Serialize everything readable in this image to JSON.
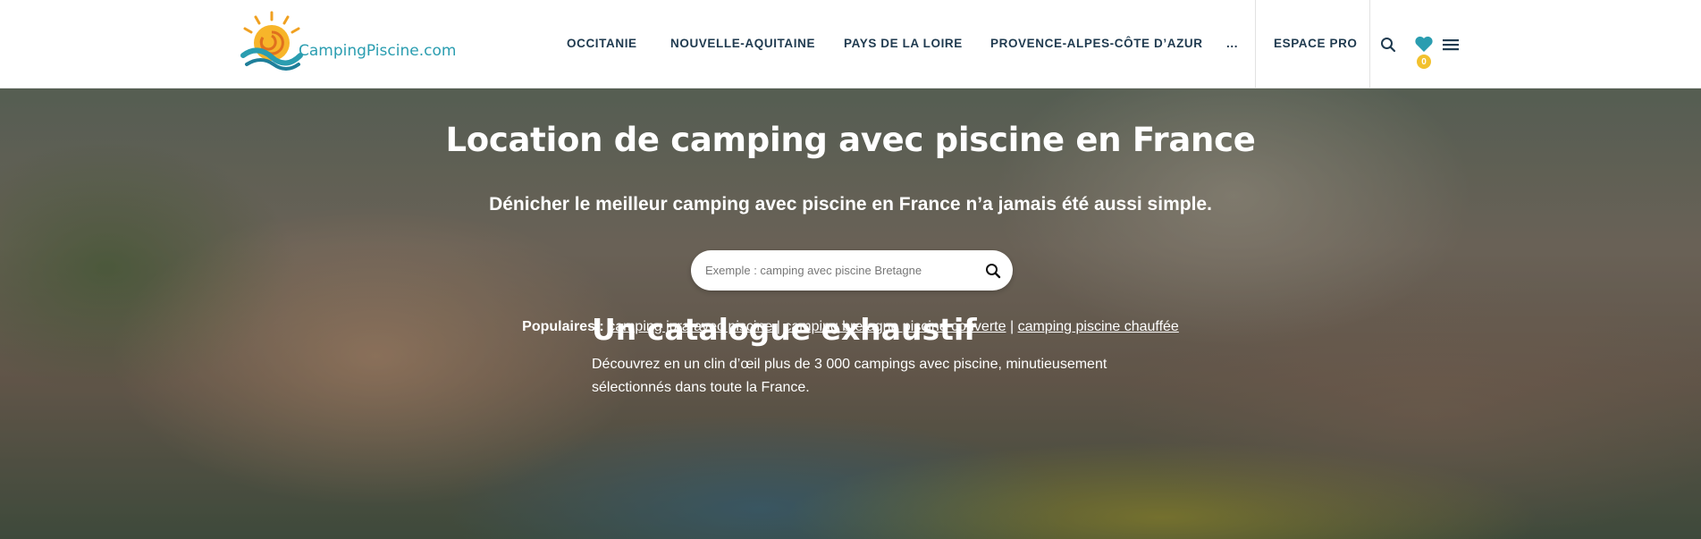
{
  "header": {
    "logo_text": "CampingPiscine.com",
    "nav": [
      {
        "label": "OCCITANIE"
      },
      {
        "label": "NOUVELLE-AQUITAINE"
      },
      {
        "label": "PAYS DE LA LOIRE"
      },
      {
        "label": "PROVENCE-ALPES-CÔTE D’AZUR"
      },
      {
        "label": "..."
      },
      {
        "label": "ESPACE PRO"
      }
    ],
    "favorites_count": "0",
    "icons": [
      "search-icon",
      "heart-icon",
      "menu-icon"
    ]
  },
  "hero": {
    "title": "Location de camping avec piscine en France",
    "subtitle": "Dénicher le meilleur camping avec piscine en France n’a jamais été aussi simple.",
    "search": {
      "placeholder": "Exemple : camping avec piscine Bretagne",
      "value": ""
    },
    "popular": {
      "label": "Populaires :",
      "links": [
        "camping jura avec piscine",
        "camping bretagne piscine couverte",
        "camping piscine chauffée"
      ],
      "separator": "|"
    }
  },
  "catalogue": {
    "title": "Un catalogue exhaustif",
    "text": "Découvrez en un clin d’œil plus de 3 000 campings avec piscine, minutieusement sélectionnés dans toute la France."
  },
  "colors": {
    "brand_teal": "#2a9db0",
    "nav_text": "#1f3a4f",
    "badge": "#f2c12e"
  }
}
